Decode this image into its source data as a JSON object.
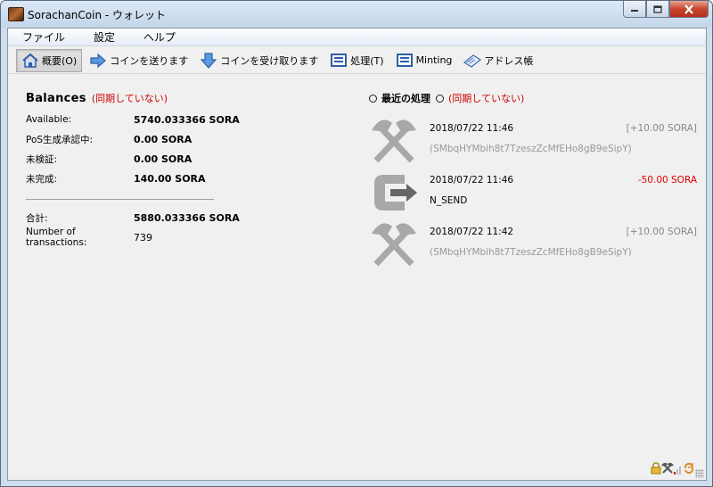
{
  "window": {
    "title": "SorachanCoin - ウォレット",
    "controls": [
      "minimize",
      "maximize",
      "close"
    ]
  },
  "menu": [
    "ファイル",
    "設定",
    "ヘルプ"
  ],
  "toolbar": [
    {
      "label": "概要(O)",
      "icon": "home-icon",
      "active": true
    },
    {
      "label": "コインを送ります",
      "icon": "send-arrow-icon"
    },
    {
      "label": "コインを受け取ります",
      "icon": "receive-arrow-icon"
    },
    {
      "label": "処理(T)",
      "icon": "transactions-list-icon"
    },
    {
      "label": "Minting",
      "icon": "minting-list-icon"
    },
    {
      "label": "アドレス帳",
      "icon": "address-book-icon"
    }
  ],
  "balances": {
    "title": "Balances",
    "out_of_sync": "(同期していない)",
    "available_label": "Available:",
    "available_value": "5740.033366 SORA",
    "pos_label": "PoS生成承認中:",
    "pos_value": "0.00 SORA",
    "unconfirmed_label": "未検証:",
    "unconfirmed_value": "0.00 SORA",
    "immature_label": "未完成:",
    "immature_value": "140.00 SORA",
    "total_label": "合計:",
    "total_value": "5880.033366 SORA",
    "numtx_label": "Number of transactions:",
    "numtx_value": "739"
  },
  "recent": {
    "title": "最近の処理",
    "out_of_sync": "(同期していない)",
    "transactions": [
      {
        "icon": "mining-pickaxe-icon",
        "date": "2018/07/22 11:46",
        "amount": "[+10.00 SORA]",
        "address": "(SMbqHYMbih8t7TzeszZcMfEHo8gB9eSipY)"
      },
      {
        "icon": "send-transaction-icon",
        "date": "2018/07/22 11:46",
        "amount": "-50.00 SORA",
        "address": "N_SEND"
      },
      {
        "icon": "mining-pickaxe-icon",
        "date": "2018/07/22 11:42",
        "amount": "[+10.00 SORA]",
        "address": "(SMbqHYMbih8t7TzeszZcMfEHo8gB9eSipY)"
      }
    ]
  },
  "status": {
    "icons": [
      "lock-icon",
      "staking-icon",
      "connections-icon",
      "sync-icon"
    ]
  },
  "colors": {
    "warning": "#d00000",
    "negative": "#e00000",
    "muted": "#999999"
  }
}
